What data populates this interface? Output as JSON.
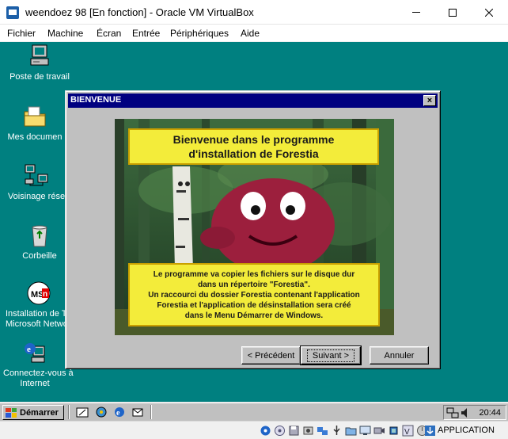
{
  "host": {
    "title": "weendoez 98 [En fonction] - Oracle VM VirtualBox",
    "menu": [
      "Fichier",
      "Machine",
      "Écran",
      "Entrée",
      "Périphériques",
      "Aide"
    ],
    "host_key_label": "APPLICATION"
  },
  "desktop": {
    "icons": [
      {
        "label": "Poste de travail",
        "icon": "my-computer-icon"
      },
      {
        "label": "Mes documen",
        "icon": "my-documents-icon"
      },
      {
        "label": "Voisinage rése",
        "icon": "network-neighborhood-icon"
      },
      {
        "label": "Corbeille",
        "icon": "recycle-bin-icon"
      },
      {
        "label": "Installation de T",
        "label2": "Microsoft Netwo",
        "icon": "msn-icon"
      },
      {
        "label": "Connectez-vous à",
        "label2": "Internet",
        "icon": "connect-internet-icon"
      }
    ]
  },
  "dialog": {
    "title": "BIENVENUE",
    "heading_line1": "Bienvenue dans le programme",
    "heading_line2": "d'installation de Forestia",
    "body_lines": [
      "Le programme va copier les fichiers sur le disque dur",
      "dans un répertoire \"Forestia\".",
      "Un raccourci du dossier Forestia contenant l'application",
      "Forestia et l'application de désinstallation sera créé",
      "dans le Menu Démarrer de Windows."
    ],
    "buttons": {
      "prev": "< Précédent",
      "next": "Suivant >",
      "cancel": "Annuler"
    }
  },
  "taskbar": {
    "start_label": "Démarrer",
    "clock": "20:44"
  },
  "colors": {
    "desktop": "#008080",
    "dialog_title": "#000080",
    "banner": "#f3ec3a"
  }
}
